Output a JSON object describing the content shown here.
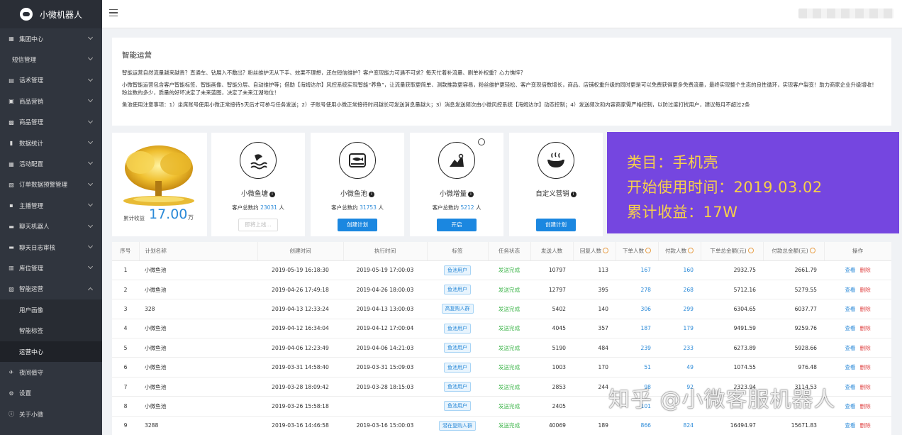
{
  "brand": {
    "name": "小微机器人"
  },
  "sidebar": {
    "items": [
      {
        "label": "集团中心",
        "icon": "building-icon",
        "chevron": "down"
      },
      {
        "label": "短信管理",
        "icon": "",
        "chevron": "down"
      },
      {
        "label": "话术管理",
        "icon": "script-icon",
        "chevron": "down"
      },
      {
        "label": "商品营销",
        "icon": "cart-icon",
        "chevron": "down"
      },
      {
        "label": "商品管理",
        "icon": "box-icon",
        "chevron": "down"
      },
      {
        "label": "数据统计",
        "icon": "bar-chart-icon",
        "chevron": "down"
      },
      {
        "label": "活动配置",
        "icon": "calendar-icon",
        "chevron": "down"
      },
      {
        "label": "订单数据预警管理",
        "icon": "alert-icon",
        "chevron": "down"
      },
      {
        "label": "主播管理",
        "icon": "user-icon",
        "chevron": "down"
      },
      {
        "label": "聊天机器人",
        "icon": "chat-icon",
        "chevron": "down"
      },
      {
        "label": "聊天日志审核",
        "icon": "chat-log-icon",
        "chevron": "down"
      },
      {
        "label": "库位管理",
        "icon": "warehouse-icon",
        "chevron": "down"
      },
      {
        "label": "智能运营",
        "icon": "dashboard-icon",
        "chevron": "up"
      }
    ],
    "subitems": [
      {
        "label": "用户画像",
        "active": false
      },
      {
        "label": "智能标签",
        "active": false
      },
      {
        "label": "运营中心",
        "active": true
      }
    ],
    "bottom_items": [
      {
        "label": "夜间值守",
        "icon": "plane-icon"
      },
      {
        "label": "设置",
        "icon": "gear-icon"
      },
      {
        "label": "关于小微",
        "icon": "info-icon"
      }
    ]
  },
  "intro": {
    "title": "智能运营",
    "p1": "智能运营自然流量越来越贵？直通车、钻展入不敷出？粉丝维护无从下手、效果不理想，还在短信维护？客户变现能力可遇不可求？每天忙着补流量、刷单补权重？心力憔悴？",
    "p2": "小微智能运营包含客户智能标签、智能画像、智能分层、自动维护等；借助【海姆达尔】风控系统实现智能“养鱼”，让流量获取更简单、测款推款更容易，粉丝维护更轻松、客户变现倍数增长，商品、店铺权重升级的同时更是可以免费获得更多免费流量，最终实现整个生态的良性循环，实现客户裂变！助力商家企业升级增收！粉丝数的多少，质量的好坏决定了未来蓝图，决定了未来江湖地位！",
    "p3": "鱼池使用注意事项：1）坐席账号使用小微正常接待5天后才可参与任务发送；2）子账号使用小微正常接待时间越长可发送消息量越大；3）消息发送频次由小微风控系统【海姆达尔】动态控制；4）发送频次和内容商家需严格控制，以防过度打扰用户，建议每月不超过2条"
  },
  "income": {
    "label": "累计收益",
    "amount": "17.00",
    "unit": "万"
  },
  "cards": [
    {
      "title": "小微鱼塘",
      "count_prefix": "客户总数约",
      "count": "23031",
      "count_suffix": "人",
      "button": "即将上线...",
      "icon": "fish-wave-icon"
    },
    {
      "title": "小微鱼池",
      "count_prefix": "客户总数约",
      "count": "31753",
      "count_suffix": "人",
      "button": "创建计划",
      "icon": "fish-pond-icon"
    },
    {
      "title": "小微增量",
      "count_prefix": "客户总数约",
      "count": "5212",
      "count_suffix": "人",
      "button": "开启",
      "icon": "growth-icon"
    },
    {
      "title": "自定义营销",
      "count_prefix": "",
      "count": "",
      "count_suffix": "",
      "button": "创建计划",
      "icon": "bowl-icon"
    }
  ],
  "overlay": {
    "line1": "类目：手机壳",
    "line2": "开始使用时间：2019.03.02",
    "line3": "累计收益：17W"
  },
  "table": {
    "headers": [
      "序号",
      "计划名称",
      "创建时间",
      "执行时间",
      "标签",
      "任务状态",
      "发送人数",
      "回复人数",
      "下单人数",
      "付款人数",
      "下单总金额(元)",
      "付款总金额(元)",
      "操作"
    ],
    "ops": {
      "view": "查看",
      "delete": "删除"
    },
    "rows": [
      {
        "no": "1",
        "name": "小微鱼池",
        "created": "2019-05-19 16:18:30",
        "executed": "2019-05-19 17:00:03",
        "tag": "鱼池用户",
        "status": "发送完成",
        "sent": "10797",
        "replied": "113",
        "ordered": "167",
        "paid": "160",
        "order_amt": "2932.75",
        "paid_amt": "2661.79"
      },
      {
        "no": "2",
        "name": "小微鱼池",
        "created": "2019-04-26 17:49:18",
        "executed": "2019-04-26 18:00:03",
        "tag": "鱼池用户",
        "status": "发送完成",
        "sent": "12797",
        "replied": "395",
        "ordered": "278",
        "paid": "268",
        "order_amt": "5712.16",
        "paid_amt": "5279.55"
      },
      {
        "no": "3",
        "name": "328",
        "created": "2019-04-13 12:33:24",
        "executed": "2019-04-13 13:00:03",
        "tag": "高复购人群",
        "status": "发送完成",
        "sent": "5402",
        "replied": "140",
        "ordered": "306",
        "paid": "299",
        "order_amt": "6304.65",
        "paid_amt": "6037.77"
      },
      {
        "no": "4",
        "name": "小微鱼池",
        "created": "2019-04-12 16:34:04",
        "executed": "2019-04-12 17:00:04",
        "tag": "鱼池用户",
        "status": "发送完成",
        "sent": "4045",
        "replied": "357",
        "ordered": "187",
        "paid": "179",
        "order_amt": "9491.59",
        "paid_amt": "9259.76"
      },
      {
        "no": "5",
        "name": "小微鱼池",
        "created": "2019-04-06 12:23:49",
        "executed": "2019-04-06 14:21:03",
        "tag": "鱼池用户",
        "status": "发送完成",
        "sent": "5190",
        "replied": "484",
        "ordered": "239",
        "paid": "233",
        "order_amt": "6273.89",
        "paid_amt": "5928.66"
      },
      {
        "no": "6",
        "name": "小微鱼池",
        "created": "2019-03-31 14:58:40",
        "executed": "2019-03-31 15:09:03",
        "tag": "鱼池用户",
        "status": "发送完成",
        "sent": "1003",
        "replied": "170",
        "ordered": "51",
        "paid": "49",
        "order_amt": "1074.55",
        "paid_amt": "976.48"
      },
      {
        "no": "7",
        "name": "小微鱼池",
        "created": "2019-03-28 18:09:42",
        "executed": "2019-03-28 18:15:03",
        "tag": "鱼池用户",
        "status": "发送完成",
        "sent": "2853",
        "replied": "244",
        "ordered": "98",
        "paid": "92",
        "order_amt": "2323.94",
        "paid_amt": "3114.53"
      },
      {
        "no": "8",
        "name": "小微鱼池",
        "created": "2019-03-26 15:58:18",
        "executed": "",
        "tag": "鱼池用户",
        "status": "发送完成",
        "sent": "2405",
        "replied": "",
        "ordered": "101",
        "paid": "",
        "order_amt": "",
        "paid_amt": ""
      },
      {
        "no": "9",
        "name": "3288",
        "created": "2019-03-16 14:46:58",
        "executed": "2019-03-16 15:00:03",
        "tag": "潜在复购人群",
        "status": "发送完成",
        "sent": "40069",
        "replied": "189",
        "ordered": "866",
        "paid": "824",
        "order_amt": "16494.97",
        "paid_amt": "15671.83"
      }
    ]
  },
  "watermark": "知乎 @小微客服机器人"
}
